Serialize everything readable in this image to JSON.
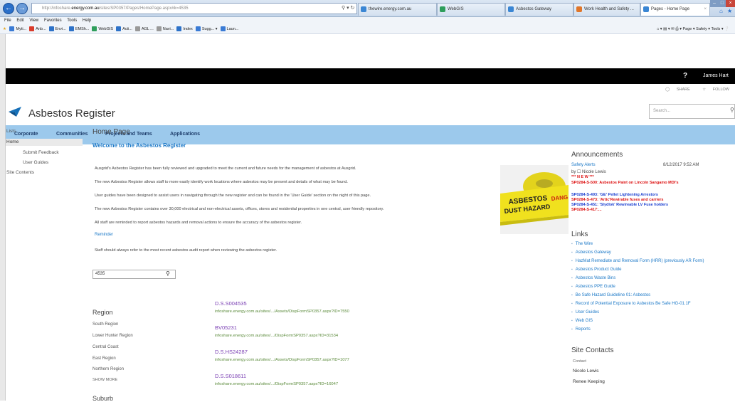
{
  "browser": {
    "address": "http://infoshare.energy.com.au/sites/SP0357/Pages/HomePage.aspx#k=4535",
    "address_domain": "energy.com.au",
    "tabs": [
      {
        "label": "thewire.energy.com.au"
      },
      {
        "label": "WebGIS"
      },
      {
        "label": "Asbestos Gateway"
      },
      {
        "label": "Work Health and Safety ..."
      },
      {
        "label": "Pages - Home Page"
      }
    ],
    "menu": [
      "File",
      "Edit",
      "View",
      "Favorites",
      "Tools",
      "Help"
    ],
    "favorites": [
      {
        "label": "Myti...",
        "color": "#3a7bd5"
      },
      {
        "label": "Anb...",
        "color": "#d93b2b"
      },
      {
        "label": "Envi...",
        "color": "#2d72c8"
      },
      {
        "label": "EMSh...",
        "color": "#2d72c8"
      },
      {
        "label": "WebGIS",
        "color": "#2e9e5b"
      },
      {
        "label": "Acti...",
        "color": "#2d72c8"
      },
      {
        "label": "AGL ...",
        "color": "#999999"
      },
      {
        "label": "Navi...",
        "color": "#999999"
      },
      {
        "label": "Index",
        "color": "#2d72c8"
      },
      {
        "label": "Sugg... ▾",
        "color": "#3a7bd5"
      },
      {
        "label": "Laun...",
        "color": "#3a7bd5"
      }
    ],
    "tools": "Page ▾  Safety ▾  Tools ▾"
  },
  "suite": {
    "help": "?",
    "user": "James Hart",
    "share": "SHARE",
    "follow": "FOLLOW"
  },
  "site": {
    "title": "Asbestos Register",
    "search_placeholder": "Search...",
    "topnav": [
      "Corporate",
      "Communities",
      "Projects and Teams",
      "Applications"
    ],
    "leftnav": {
      "lists": "Lists",
      "home": "Home",
      "submit_feedback": "Submit Feedback",
      "user_guides": "User Guides",
      "site_contents": "Site Contents"
    }
  },
  "main": {
    "breadcrumb": "Home Page",
    "welcome": "Welcome to the Asbestos Register",
    "paragraphs": [
      "Ausgrid's Asbestos Register has been fully reviewed and upgraded to meet the current and future needs for the management of asbestos at Ausgrid.",
      "The new Asbestos Register allows staff to more easily identify work locations where asbestos may be present and details of what may be found.",
      "User guides have been designed to assist users in navigating through the new register and can be found in the 'User Guide' section on the night of this page.",
      "The new Asbestos Register contains over 30,000 electrical and non-electrical assets, offices, stores and residential properties in one central, user friendly repository.",
      "All staff are reminded to report asbestos hazards and removal actions to ensure the accuracy of the asbestos register."
    ],
    "reminder": "Reminder",
    "audit_note": "Staff should always refer to the most recent asbestos audit report when reviewing the asbestos register.",
    "search_value": "4535",
    "refiners": {
      "region_title": "Region",
      "regions": [
        "South Region",
        "Lower Hunter Region",
        "Central Coast",
        "East Region",
        "Northern Region"
      ],
      "show_more": "SHOW MORE",
      "suburb_title": "Suburb"
    },
    "results": [
      {
        "title": "D.S.S004535",
        "url": "infoshare.energy.com.au/sites/.../Assets/DispFormSP0357.aspx?ID=7550"
      },
      {
        "title": "BV05231",
        "url": "infoshare.energy.com.au/sites/.../DispFormSP0357.aspx?ID=31534"
      },
      {
        "title": "D.S.HS24287",
        "url": "infoshare.energy.com.au/sites/.../Assets/DispFormSP0357.aspx?ID=1077"
      },
      {
        "title": "D.S.S018611",
        "url": "infoshare.energy.com.au/sites/.../DispFormSP0357.aspx?ID=16047"
      }
    ]
  },
  "announcements": {
    "title": "Announcements",
    "item": "Safety Alerts",
    "date": "8/12/2017 9:52 AM",
    "by": "by ☐ Nicole Lewis",
    "new": "*** N E W ***",
    "lines": [
      {
        "text": "SP0284-S-500: Asbestos Paint on Lincoln Sangamo MDI's",
        "color": "red"
      },
      {
        "text": "SP0284-S-493: 'GE' Pellet Lightening Arrestors",
        "color": "blue"
      },
      {
        "text": "SP0284-S-473: 'Artic'Rewirable fuses and carriers",
        "color": "red"
      },
      {
        "text": "SP0284-S-451: 'Slydlok' Rewireable LV Fuse holders",
        "color": "blue"
      },
      {
        "text": "SP0284-S-417:...",
        "color": "red"
      }
    ],
    "tape_text_1": "ASBESTOS",
    "tape_text_2": "DUST HAZARD",
    "tape_text_3": "DANG"
  },
  "links": {
    "title": "Links",
    "items": [
      "The Wire",
      "Asbestos Gateway",
      "HazMat Remediate and Removal Form (HRR) (previously AR Form)",
      "Asbestos Product Guide",
      "Asbestos Waste Bins",
      "Asbestos PPE Guide",
      "Be Safe Hazard Guideline 01: Asbestos",
      "Record of Potential Exposure to Asbestos Be Safe HG-01.1F",
      "User Guides",
      "Web GIS",
      "Reports"
    ]
  },
  "contacts": {
    "title": "Site Contacts",
    "label": "Contact",
    "people": [
      "Nicole Lewis",
      "Renee Keeping"
    ]
  }
}
